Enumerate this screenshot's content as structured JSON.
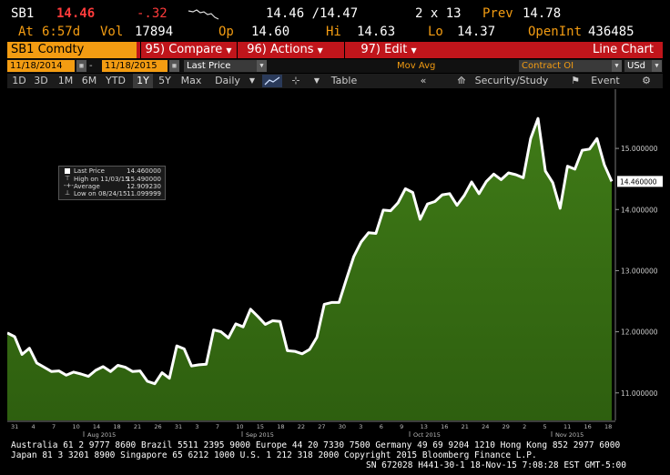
{
  "quote": {
    "ticker": "SB1",
    "last": "14.46",
    "change": "-.32",
    "bid_ask": "14.46 /14.47",
    "size": "2 x 13",
    "prev_label": "Prev",
    "prev": "14.78",
    "at_label": "At",
    "time": "6:57d",
    "vol_label": "Vol",
    "volume": "17894",
    "op_label": "Op",
    "open": "14.60",
    "hi_label": "Hi",
    "high": "14.63",
    "lo_label": "Lo",
    "low": "14.37",
    "oi_label": "OpenInt",
    "open_interest": "436485"
  },
  "menu": {
    "security": "SB1 Comdty",
    "compare": "95) Compare",
    "actions": "96) Actions",
    "edit": "97) Edit",
    "chart_type": "Line Chart"
  },
  "toolbar": {
    "start_date": "11/18/2014",
    "end_date": "11/18/2015",
    "price_field": "Last Price",
    "study_label": "Mov Avg",
    "lower_field": "Contract OI",
    "currency": "USd"
  },
  "ranges": {
    "buttons": [
      "1D",
      "3D",
      "1M",
      "6M",
      "YTD",
      "1Y",
      "5Y",
      "Max"
    ],
    "active": "1Y",
    "frequency": "Daily",
    "table": "Table",
    "security_study": "Security/Study",
    "event": "Event"
  },
  "legend": {
    "rows": [
      {
        "label": "Last Price",
        "value": "14.460000"
      },
      {
        "label": "High on 11/03/15",
        "value": "15.490000"
      },
      {
        "label": "Average",
        "value": "12.909230"
      },
      {
        "label": "Low on 08/24/15",
        "value": "11.099999"
      }
    ]
  },
  "chart_data": {
    "type": "area",
    "series": [
      {
        "name": "Last Price",
        "values": [
          11.98,
          11.92,
          11.63,
          11.73,
          11.49,
          11.42,
          11.35,
          11.36,
          11.29,
          11.34,
          11.31,
          11.27,
          11.37,
          11.43,
          11.35,
          11.45,
          11.42,
          11.35,
          11.36,
          11.19,
          11.15,
          11.33,
          11.24,
          11.77,
          11.72,
          11.44,
          11.46,
          11.47,
          12.03,
          12.0,
          11.9,
          12.13,
          12.08,
          12.37,
          12.25,
          12.12,
          12.18,
          12.17,
          11.69,
          11.68,
          11.64,
          11.71,
          11.91,
          12.45,
          12.48,
          12.48,
          12.86,
          13.23,
          13.47,
          13.62,
          13.61,
          13.99,
          13.98,
          14.11,
          14.34,
          14.28,
          13.84,
          14.09,
          14.13,
          14.24,
          14.26,
          14.07,
          14.23,
          14.45,
          14.26,
          14.46,
          14.58,
          14.49,
          14.6,
          14.57,
          14.52,
          15.16,
          15.49,
          14.63,
          14.44,
          14.02,
          14.71,
          14.66,
          14.97,
          14.99,
          15.16,
          14.73,
          14.46
        ]
      }
    ],
    "x_ticks_top": [
      "31",
      "4",
      "7",
      "10",
      "14",
      "18",
      "21",
      "26",
      "31",
      "3",
      "7",
      "10",
      "15",
      "18",
      "22",
      "27",
      "30",
      "3",
      "6",
      "9",
      "13",
      "16",
      "21",
      "24",
      "29",
      "2",
      "5",
      "11",
      "16",
      "18"
    ],
    "month_labels": [
      "Aug 2015",
      "Sep 2015",
      "Oct 2015",
      "Nov 2015"
    ],
    "y_ticks": [
      "15.000000",
      "14.000000",
      "13.000000",
      "12.000000",
      "11.000000"
    ],
    "y_values": [
      15,
      14,
      13,
      12,
      11
    ],
    "last_label": "14.460000",
    "ylim": [
      10.55,
      15.85
    ],
    "fill_color": "#3f7a17",
    "line_color": "#ffffff",
    "grid": false
  },
  "footer": {
    "line1": "Australia 61 2 9777 8600 Brazil 5511 2395 9000 Europe 44 20 7330 7500 Germany 49 69 9204 1210 Hong Kong 852 2977 6000",
    "line2": "Japan 81 3 3201 8900       Singapore 65 6212 1000      U.S. 1 212 318 2000      Copyright 2015 Bloomberg Finance L.P.",
    "line3": "SN 672028 H441-30-1 18-Nov-15  7:08:28 EST  GMT-5:00"
  }
}
